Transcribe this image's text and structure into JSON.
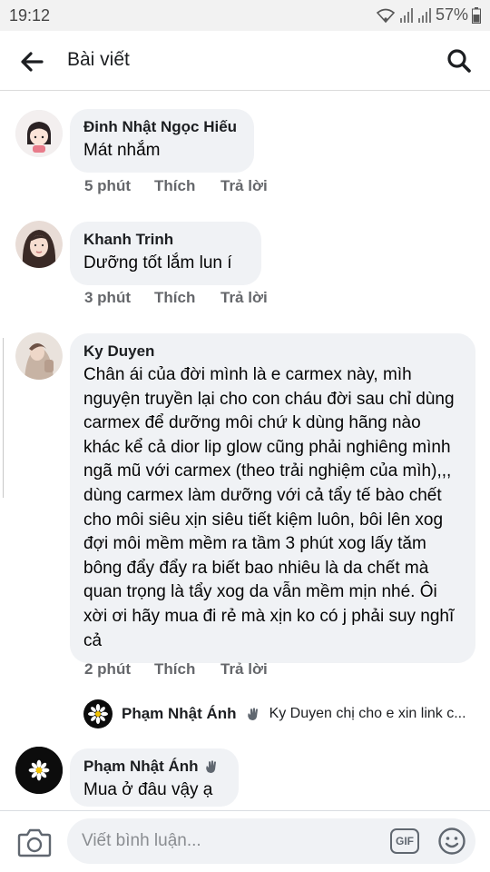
{
  "status_bar": {
    "time": "19:12",
    "battery_percent": "57%",
    "icons": [
      "wifi-icon",
      "signal-icon",
      "signal-icon",
      "battery-icon"
    ]
  },
  "header": {
    "title": "Bài viết",
    "back_icon": "back-arrow-icon",
    "search_icon": "search-icon"
  },
  "comments": [
    {
      "author": "Đinh Nhật Ngọc Hiếu",
      "text": "Mát nhắm",
      "time": "5 phút",
      "like": "Thích",
      "reply": "Trả lời"
    },
    {
      "author": "Khanh Trinh",
      "text": "Dưỡng tốt lắm lun í",
      "time": "3 phút",
      "like": "Thích",
      "reply": "Trả lời"
    },
    {
      "author": "Ky Duyen",
      "text": "Chân ái của đời mình là e carmex này, mìh nguyện truyền lại cho con cháu đời sau chỉ dùng carmex để dưỡng môi chứ k dùng hãng nào khác kể cả dior lip glow cũng phải nghiêng mình ngã mũ với carmex (theo trải nghiệm của mìh),,, dùng carmex làm dưỡng với cả tẩy tế bào chết cho môi siêu xịn siêu tiết kiệm luôn, bôi lên xog đợi môi mềm mềm ra tầm 3 phút xog lấy tăm bông đẩy đẩy ra biết bao nhiêu là da chết mà quan trọng là tẩy xog da vẫn mềm mịn nhé. Ôi xời ơi hãy mua đi rẻ mà xịn ko có j phải suy nghĩ cả",
      "time": "2 phút",
      "like": "Thích",
      "reply": "Trả lời",
      "reply_preview": {
        "author": "Phạm Nhật Ánh",
        "text": "Ky Duyen chị cho e xin link c..."
      }
    },
    {
      "author": "Phạm Nhật Ánh",
      "text": "Mua ở đâu vậy ạ"
    }
  ],
  "composer": {
    "placeholder": "Viết bình luận...",
    "gif_label": "GIF",
    "camera_icon": "camera-icon",
    "emoji_icon": "smiley-icon"
  }
}
